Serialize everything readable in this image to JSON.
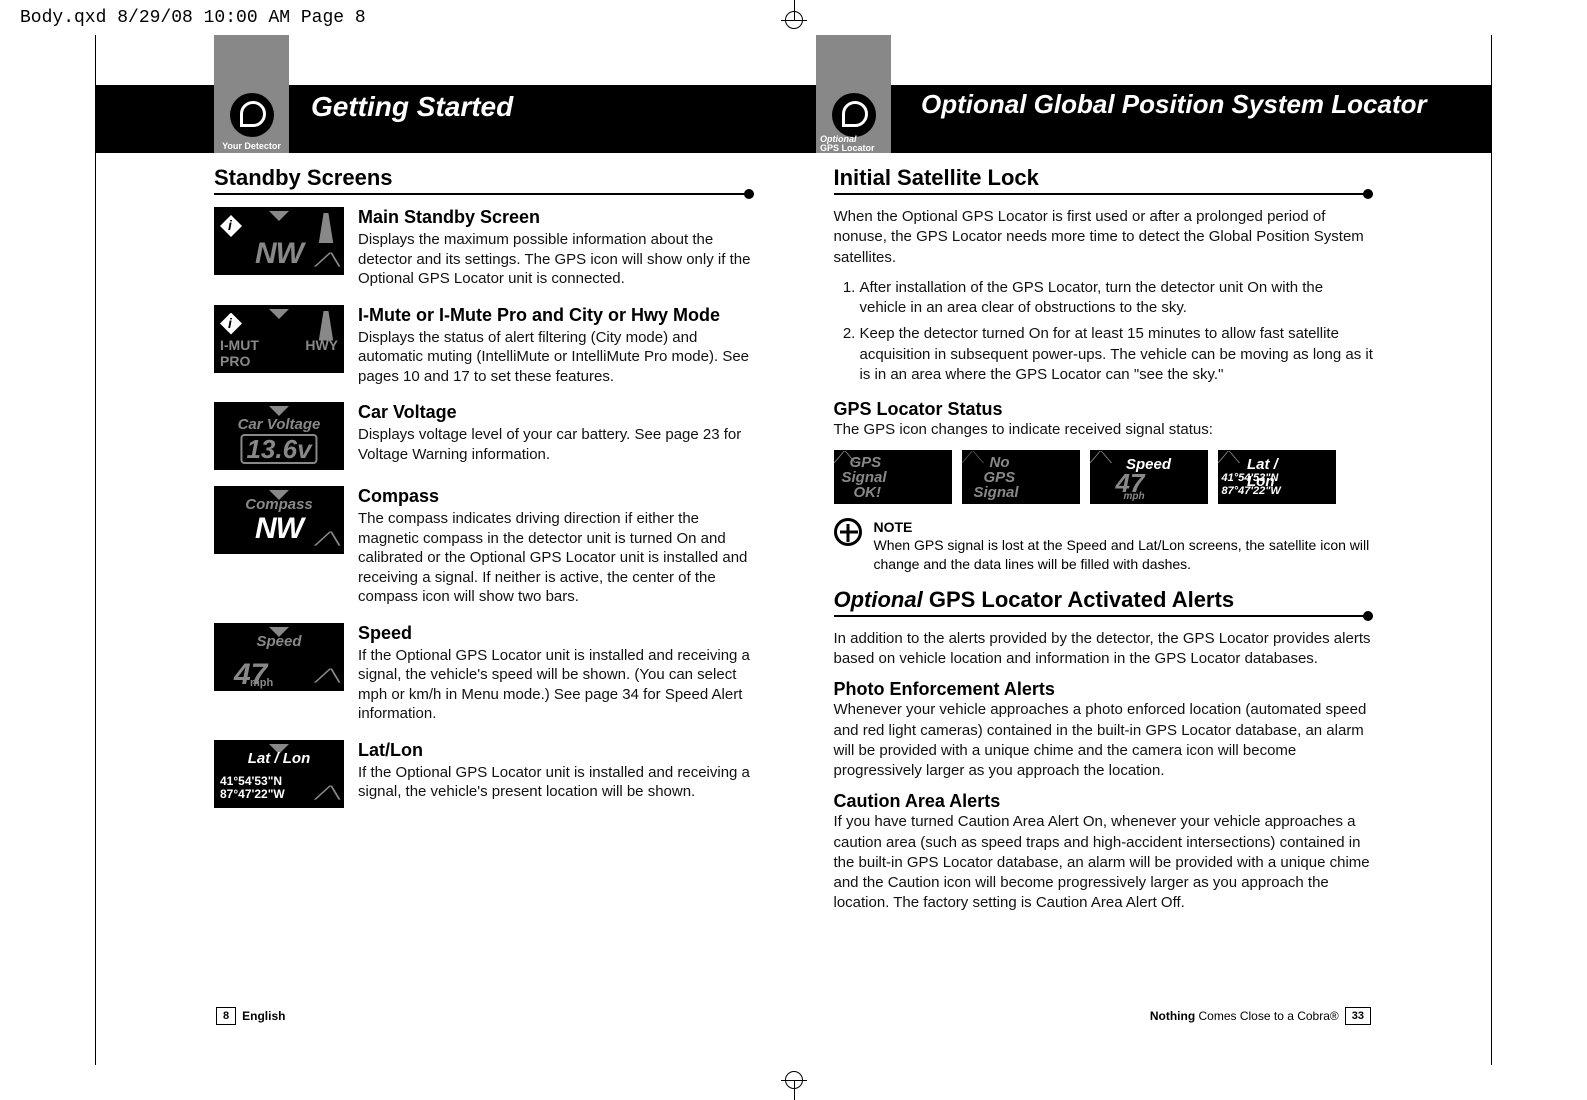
{
  "print_header": "Body.qxd  8/29/08  10:00 AM  Page 8",
  "left_tab_label": "Your Detector",
  "right_tab_label_1": "Optional",
  "right_tab_label_2": "GPS Locator",
  "band_left_title": "Getting Started",
  "band_right_title_ital": "Optional",
  "band_right_title_rest": " Global Position System Locator",
  "left": {
    "section": "Standby Screens",
    "items": [
      {
        "title": "Main Standby Screen",
        "body": "Displays the maximum possible information about the detector and its settings. The GPS icon will show only if the Optional GPS Locator unit is connected.",
        "lcd_big": "NW"
      },
      {
        "title": "I-Mute or I-Mute Pro and City or Hwy Mode",
        "body": "Displays the status of alert filtering (City mode) and automatic muting (IntelliMute or IntelliMute Pro mode). See pages 10 and 17 to set these features.",
        "lcd_l1": "I-MUT",
        "lcd_l2": "PRO",
        "lcd_r1": "HWY"
      },
      {
        "title": "Car Voltage",
        "body": "Displays voltage level of your car battery. See page 23 for Voltage Warning information.",
        "lcd_hdr": "Car Voltage",
        "lcd_volt": "13.6v"
      },
      {
        "title": "Compass",
        "body": "The compass indicates driving direction if either the magnetic compass in the detector unit is turned On and calibrated or the Optional GPS Locator unit is installed and receiving a signal. If neither is active, the center of the compass icon will show two bars.",
        "lcd_hdr": "Compass",
        "lcd_big": "NW"
      },
      {
        "title": "Speed",
        "body": "If the Optional GPS Locator unit is installed and receiving a signal, the vehicle's speed will be shown. (You can select mph or km/h in Menu mode.) See page 34 for Speed Alert information.",
        "lcd_hdr": "Speed",
        "lcd_big": "47",
        "lcd_unit": "mph"
      },
      {
        "title": "Lat/Lon",
        "body": "If the Optional GPS Locator unit is installed and receiving a signal, the vehicle's present location will be shown.",
        "lcd_hdr": "Lat / Lon",
        "lcd_c1": "41°54'53\"N",
        "lcd_c2": "87°47'22\"W"
      }
    ]
  },
  "right": {
    "section1": "Initial Satellite Lock",
    "p1": "When the Optional GPS Locator is first used or after a prolonged period of nonuse, the GPS Locator needs more time to detect the Global Position System satellites.",
    "steps": [
      "After installation of the GPS Locator, turn the detector unit On with the vehicle in an area clear of obstructions to the sky.",
      "Keep the detector turned On for at least 15 minutes to allow fast satellite acquisition in subsequent power-ups. The vehicle can be moving as long as it is in an area where the GPS Locator can \"see the sky.\""
    ],
    "status_h": "GPS Locator Status",
    "status_p": "The GPS icon changes to indicate received signal status:",
    "status": {
      "ok1": "GPS",
      "ok2": "Signal",
      "ok3": "OK!",
      "no1": "No",
      "no2": "GPS",
      "no3": "Signal",
      "spd_h": "Speed",
      "spd_v": "47",
      "spd_u": "mph",
      "ll_h": "Lat / Lon",
      "ll_1": "41°54'53\"N",
      "ll_2": "87°47'22\"W"
    },
    "note_h": "NOTE",
    "note_body": "When GPS signal is lost at the Speed and Lat/Lon screens, the satellite icon will change and the data lines will be filled with dashes.",
    "section2_ital": "Optional",
    "section2_rest": " GPS Locator Activated Alerts",
    "p2": "In addition to the alerts provided by the detector, the GPS Locator provides alerts based on vehicle location and information in the GPS Locator databases.",
    "photo_h": "Photo Enforcement Alerts",
    "photo_p": "Whenever your vehicle approaches a photo enforced location (automated speed and red light cameras) contained in the built-in GPS Locator database, an alarm will be provided with a unique chime and the camera icon will become progressively larger as you approach the location.",
    "caution_h": "Caution Area Alerts",
    "caution_p": "If you have turned Caution Area Alert On, whenever your vehicle approaches a caution area (such as speed traps and high-accident intersections) contained in the built-in GPS Locator database, an alarm will be provided with a unique chime and the Caution icon will become progressively larger as you approach the location. The factory setting is Caution Area Alert Off."
  },
  "footer": {
    "left_page": "8",
    "left_lang": "English",
    "right_text_bold": "Nothing",
    "right_text_rest": " Comes Close to a Cobra®",
    "right_page": "33"
  }
}
